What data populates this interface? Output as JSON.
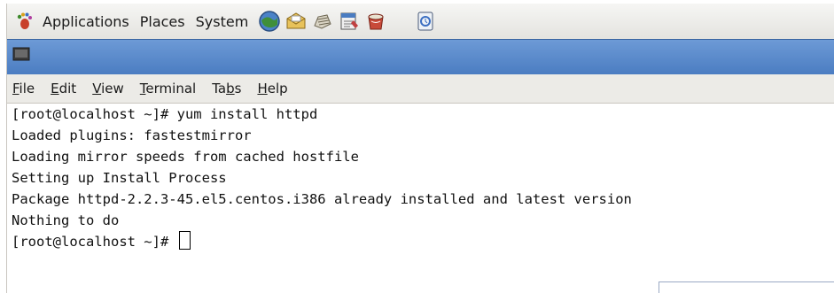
{
  "panel": {
    "menus": [
      {
        "label": "Applications",
        "icon": "gnome-foot-icon"
      },
      {
        "label": "Places"
      },
      {
        "label": "System"
      }
    ],
    "launchers": [
      "web-browser-icon",
      "email-icon",
      "editor-icon",
      "notes-icon",
      "office-icon"
    ],
    "extra_launcher": "screenshot-icon"
  },
  "window": {
    "title_icon": "terminal-icon",
    "accent": "#4a7cc1"
  },
  "menubar": {
    "file_pre": "",
    "file_mn": "F",
    "file_post": "ile",
    "edit_pre": "",
    "edit_mn": "E",
    "edit_post": "dit",
    "view_pre": "",
    "view_mn": "V",
    "view_post": "iew",
    "terminal_pre": "",
    "terminal_mn": "T",
    "terminal_post": "erminal",
    "tabs_pre": "Ta",
    "tabs_mn": "b",
    "tabs_post": "s",
    "help_pre": "",
    "help_mn": "H",
    "help_post": "elp"
  },
  "terminal": {
    "lines": [
      "[root@localhost ~]# yum install httpd",
      "Loaded plugins: fastestmirror",
      "Loading mirror speeds from cached hostfile",
      "Setting up Install Process",
      "Package httpd-2.2.3-45.el5.centos.i386 already installed and latest version",
      "Nothing to do"
    ],
    "prompt": "[root@localhost ~]# "
  }
}
